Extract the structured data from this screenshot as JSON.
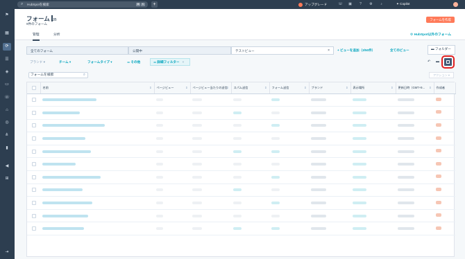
{
  "topbar": {
    "search_placeholder": "HubSpotを検索",
    "kbd1": "⌘",
    "kbd2": "K",
    "upgrade": "アップグレード",
    "copilot": "Copilot"
  },
  "header": {
    "title": "フォーム",
    "cursor_text": "JB",
    "subtitle": "9件のフォーム",
    "create_button": "フォームを作成",
    "tabs": [
      "管理",
      "分析"
    ],
    "external_link": "HubSpot以外のフォーム"
  },
  "views": {
    "tabs": [
      "全てのフォーム",
      "公開中",
      "テストビュー"
    ],
    "add_view": "ビューを追加（3/50件）",
    "all_views": "全てのビュー",
    "folder": "フォルダー"
  },
  "filters": {
    "brand": "ブランド",
    "team": "チーム",
    "form_type": "フォームタイプ",
    "more": "その他",
    "advanced": "詳細フィルター"
  },
  "search": {
    "placeholder": "フォームを検索",
    "actions": "アクション"
  },
  "table": {
    "columns": [
      "名前",
      "ページビュー",
      "ページビュー当たりの送信",
      "スパム送信",
      "フォーム送信",
      "ブランド",
      "表示場所",
      "更新日時（GMT+9...",
      "作成者"
    ],
    "row_count": 11
  },
  "colors": {
    "nav": "#2d3e50",
    "accent": "#ff7a59",
    "link": "#00a4bd",
    "highlight": "#e02020"
  }
}
